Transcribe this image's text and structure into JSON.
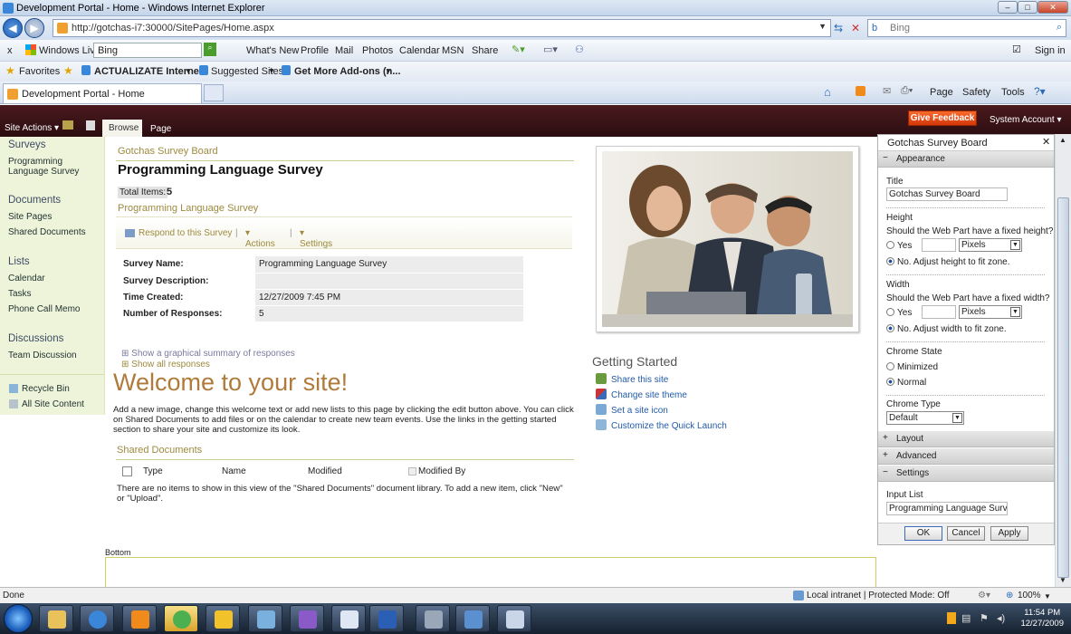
{
  "window": {
    "title": "Development Portal - Home - Windows Internet Explorer"
  },
  "address": {
    "url": "http://gotchas-i7:30000/SitePages/Home.aspx",
    "search_placeholder": "Bing"
  },
  "wlbar": {
    "close": "x",
    "brand": "Windows Live",
    "search_value": "Bing",
    "links": [
      "What's New",
      "Profile",
      "Mail",
      "Photos",
      "Calendar",
      "MSN",
      "Share"
    ],
    "signin": "Sign in"
  },
  "favbar": {
    "favorites": "Favorites",
    "items": [
      "ACTUALIZATE Interne...",
      "Suggested Sites",
      "Get More Add-ons (n..."
    ]
  },
  "tabbar": {
    "tab": "Development Portal - Home",
    "tools": [
      "Page",
      "Safety",
      "Tools"
    ]
  },
  "ribbon": {
    "site_actions": "Site Actions",
    "tab_browse": "Browse",
    "tab_page": "Page",
    "feedback": "Give Feedback",
    "account": "System Account"
  },
  "quicklaunch": {
    "surveys": "Surveys",
    "survey_item": "Programming Language Survey",
    "documents": "Documents",
    "doc_items": [
      "Site Pages",
      "Shared Documents"
    ],
    "lists": "Lists",
    "list_items": [
      "Calendar",
      "Tasks",
      "Phone Call Memo"
    ],
    "discussions": "Discussions",
    "disc_items": [
      "Team Discussion"
    ],
    "recycle": "Recycle Bin",
    "all_content": "All Site Content"
  },
  "survey": {
    "board": "Gotchas Survey Board",
    "title": "Programming Language Survey",
    "total_label": "Total Items:",
    "total_value": "5",
    "link": "Programming Language Survey",
    "respond": "Respond to this Survey",
    "actions": "Actions",
    "settings": "Settings",
    "details": [
      {
        "k": "Survey Name:",
        "v": "Programming Language Survey"
      },
      {
        "k": "Survey Description:",
        "v": ""
      },
      {
        "k": "Time Created:",
        "v": "12/27/2009 7:45 PM"
      },
      {
        "k": "Number of Responses:",
        "v": "5"
      }
    ],
    "show_summary": "Show a graphical summary of responses",
    "show_all": "Show all responses"
  },
  "welcome": {
    "title": "Welcome to your site!",
    "text": "Add a new image, change this welcome text or add new lists to this page by clicking the edit button above. You can click on Shared Documents to add files or on the calendar to create new team events. Use the links in the getting started section to share your site and customize its look."
  },
  "shared_docs": {
    "title": "Shared Documents",
    "cols": [
      "Type",
      "Name",
      "Modified",
      "Modified By"
    ],
    "empty": "There are no items to show in this view of the \"Shared Documents\" document library. To add a new item, click \"New\" or \"Upload\"."
  },
  "getting_started": {
    "title": "Getting Started",
    "links": [
      "Share this site",
      "Change site theme",
      "Set a site icon",
      "Customize the Quick Launch"
    ]
  },
  "bottom": {
    "label": "Bottom"
  },
  "toolpane": {
    "title": "Gotchas Survey Board",
    "appearance": "Appearance",
    "title_label": "Title",
    "title_value": "Gotchas Survey Board",
    "height_label": "Height",
    "height_q": "Should the Web Part have a fixed height?",
    "yes": "Yes",
    "pixels": "Pixels",
    "height_no": "No. Adjust height to fit zone.",
    "width_label": "Width",
    "width_q": "Should the Web Part have a fixed width?",
    "width_no": "No. Adjust width to fit zone.",
    "chrome_state": "Chrome State",
    "minimized": "Minimized",
    "normal": "Normal",
    "chrome_type": "Chrome Type",
    "chrome_type_value": "Default",
    "layout": "Layout",
    "advanced": "Advanced",
    "settings": "Settings",
    "input_list": "Input List",
    "input_value": "Programming Language Survey",
    "ok": "OK",
    "cancel": "Cancel",
    "apply": "Apply"
  },
  "status": {
    "left": "Done",
    "zone": "Local intranet | Protected Mode: Off",
    "zoom": "100%"
  },
  "taskbar": {
    "time": "11:54 PM",
    "date": "12/27/2009"
  },
  "icons": {
    "back": "back-arrow-icon",
    "forward": "forward-arrow-icon",
    "refresh": "refresh-icon",
    "stop": "stop-icon",
    "home": "home-icon",
    "rss": "rss-icon",
    "print": "print-icon",
    "help": "help-icon"
  }
}
